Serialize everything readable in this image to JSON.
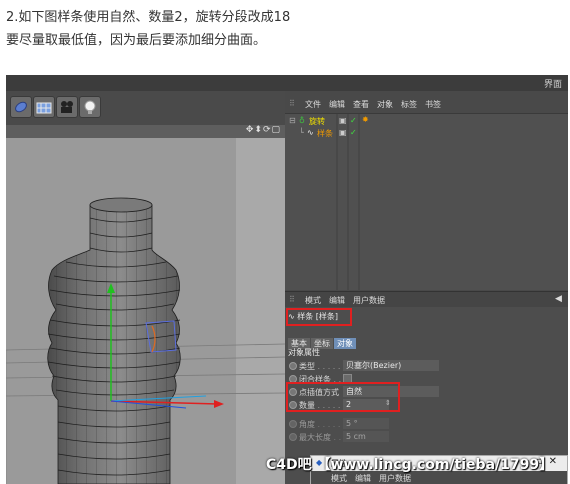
{
  "intro": {
    "line1": "2.如下图样条使用自然、数量2，旋转分段改成18",
    "line2": "要尽量取最低值，因为最后要添加细分曲面。"
  },
  "screenshot": {
    "topbar_right": "界面",
    "viewport": {
      "nav_icons": "✥⬍⟳▢"
    },
    "object_manager": {
      "menu": [
        "文件",
        "编辑",
        "查看",
        "对象",
        "标签",
        "书签"
      ],
      "items": [
        {
          "label": "旋转",
          "color": "#f0e000"
        },
        {
          "label": "样条",
          "color": "#f09a00"
        }
      ]
    },
    "attribute_manager": {
      "menu": [
        "模式",
        "编辑",
        "用户数据"
      ],
      "object_title": "样条 [样条]",
      "tabs": [
        "基本",
        "坐标",
        "对象"
      ],
      "active_tab": "对象",
      "section_title": "对象属性",
      "properties": [
        {
          "label": "类型",
          "value": "贝塞尔(Bezier)"
        },
        {
          "label": "闭合样条",
          "value": ""
        },
        {
          "label": "点插值方式",
          "value": "自然"
        },
        {
          "label": "数量",
          "value": "2"
        },
        {
          "label": "角度",
          "value": "5 °"
        },
        {
          "label": "最大长度",
          "value": "5 cm"
        }
      ]
    },
    "mini_window": {
      "title": "属性",
      "menu": [
        "模式",
        "编辑",
        "用户数据"
      ]
    }
  },
  "watermark": "C4D吧 【www.lincg.com/tieba/1799】",
  "colors": {
    "highlight_box": "#e02020",
    "axis_y": "#20c020",
    "axis_x": "#e02020",
    "axis_z": "#2050e0"
  }
}
